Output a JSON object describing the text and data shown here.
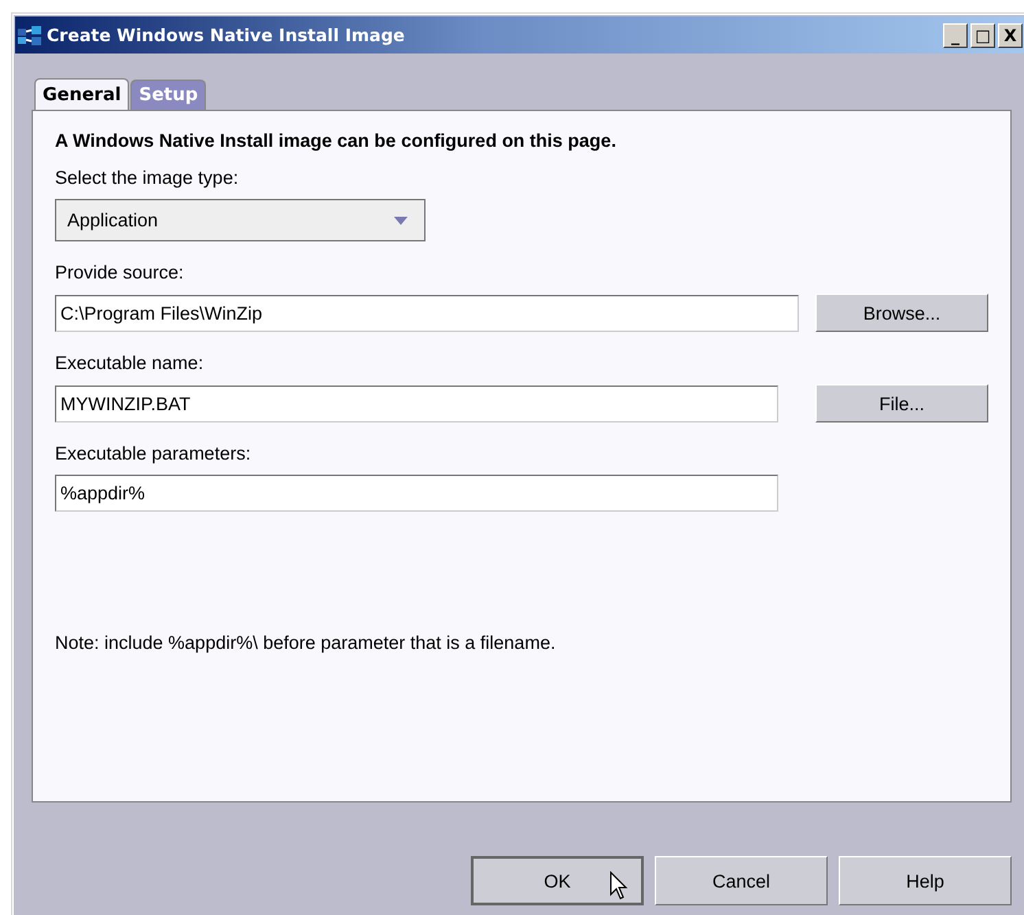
{
  "window": {
    "title": "Create Windows Native Install Image",
    "controls": [
      "_",
      "□",
      "X"
    ]
  },
  "tabs": [
    {
      "label": "General",
      "selected": true
    },
    {
      "label": "Setup",
      "selected": false
    }
  ],
  "heading": "A Windows Native Install image can be configured on this page.",
  "image_type": {
    "label": "Select the image type:",
    "value": "Application"
  },
  "fields": [
    {
      "label": "Provide source:",
      "value": "C:\\Program Files\\WinZip",
      "button": "Browse..."
    },
    {
      "label": "Executable name:",
      "value": "MYWINZIP.BAT",
      "button": "File..."
    },
    {
      "label": "Executable parameters:",
      "value": "%appdir%"
    }
  ],
  "note": "Note: include %appdir%\\ before parameter that is a filename.",
  "buttons": [
    {
      "label": "OK",
      "default": true
    },
    {
      "label": "Cancel",
      "default": false
    },
    {
      "label": "Help",
      "default": false
    }
  ]
}
